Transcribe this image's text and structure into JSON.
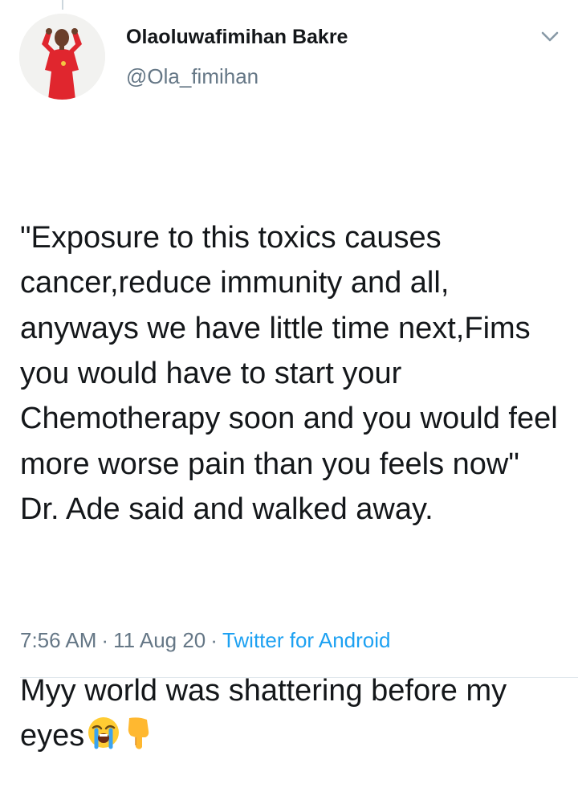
{
  "author": {
    "display_name": "Olaoluwafimihan Bakre",
    "handle": "@Ola_fimihan",
    "avatar_icon": "profile-photo"
  },
  "tweet": {
    "paragraph_1": "\"Exposure to this toxics causes cancer,reduce immunity and all, anyways we have little time next,Fims you would have to start your Chemotherapy soon and you would feel more worse pain than you feels now\" Dr. Ade said and walked away.",
    "paragraph_2": "Myy world was shattering before my eyes",
    "emojis": [
      "loudly-crying-face",
      "backhand-index-pointing-down"
    ]
  },
  "meta": {
    "time": "7:56 AM",
    "separator": "·",
    "date": "11 Aug 20",
    "source": "Twitter for Android"
  },
  "colors": {
    "text": "#14171a",
    "secondary": "#657786",
    "link": "#1da1f2"
  }
}
